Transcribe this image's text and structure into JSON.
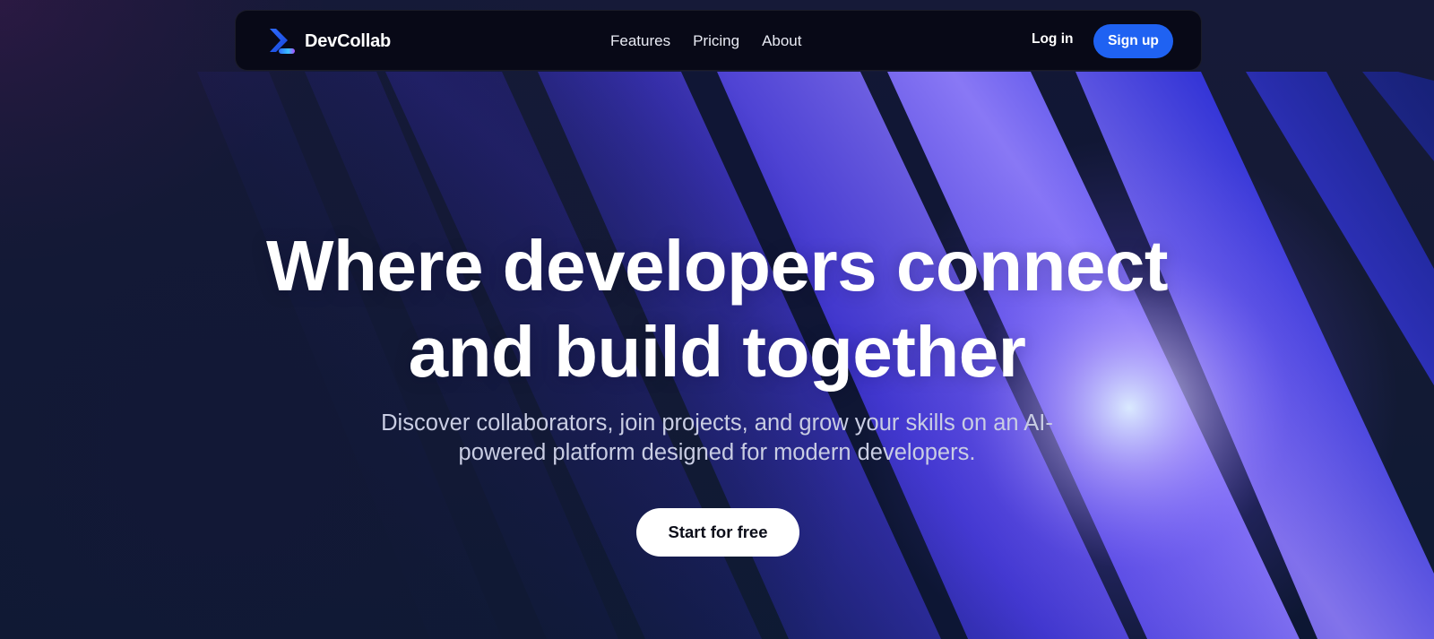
{
  "brand": {
    "name": "DevCollab",
    "logo_icon": "chevron-play-logo-icon"
  },
  "nav": {
    "links": [
      "Features",
      "Pricing",
      "About"
    ],
    "login_label": "Log in",
    "signup_label": "Sign up"
  },
  "hero": {
    "headline_line1": "Where developers connect",
    "headline_line2": "and build together",
    "subline_line1": "Discover collaborators, join projects, and grow your skills on an AI-",
    "subline_line2": "powered platform designed for modern developers.",
    "cta_label": "Start for free"
  },
  "colors": {
    "background": "#141a35",
    "accent": "#1f62f2",
    "beam": "#5a3cf0",
    "beam_glow": "#cfe0ff",
    "navbar": "#080914"
  }
}
